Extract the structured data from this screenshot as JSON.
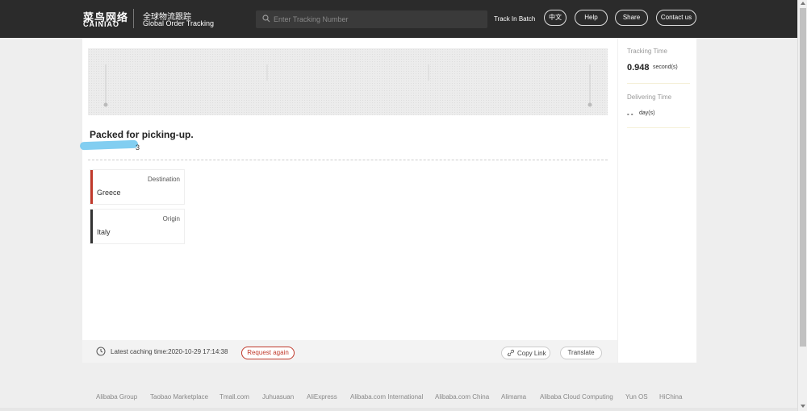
{
  "header": {
    "logo_cn": "菜鸟网络",
    "logo_en": "CAINIAO",
    "subtitle_cn": "全球物流跟踪",
    "subtitle_en": "Global Order Tracking",
    "search_placeholder": "Enter Tracking Number",
    "track_batch": "Track In Batch",
    "lang_button": "中文",
    "help_button": "Help",
    "share_button": "Share",
    "contact_button": "Contact us"
  },
  "tracking": {
    "status": "Packed for picking-up.",
    "tracking_number_visible_tail": "3",
    "destination_label": "Destination",
    "destination_value": "Greece",
    "origin_label": "Origin",
    "origin_value": "Italy",
    "cache_time": "Latest caching time:2020-10-29 17:14:38",
    "request_again": "Request again",
    "copy_link": "Copy Link",
    "translate": "Translate"
  },
  "side": {
    "tracking_time_label": "Tracking Time",
    "tracking_time_value": "0.948",
    "tracking_time_unit": "second(s)",
    "delivering_time_label": "Delivering Time",
    "delivering_time_value": "- -",
    "delivering_time_unit": "day(s)"
  },
  "footer": {
    "links": [
      "Alibaba Group",
      "Taobao Marketplace",
      "Tmall.com",
      "Juhuasuan",
      "AliExpress",
      "Alibaba.com International",
      "Alibaba.com China",
      "Alimama",
      "Alibaba Cloud Computing",
      "Yun OS",
      "HiChina"
    ]
  },
  "colors": {
    "header_bg": "#2b2b2b",
    "destination_bar": "#c0392b",
    "origin_bar": "#333333",
    "request_again": "#c0392b"
  }
}
